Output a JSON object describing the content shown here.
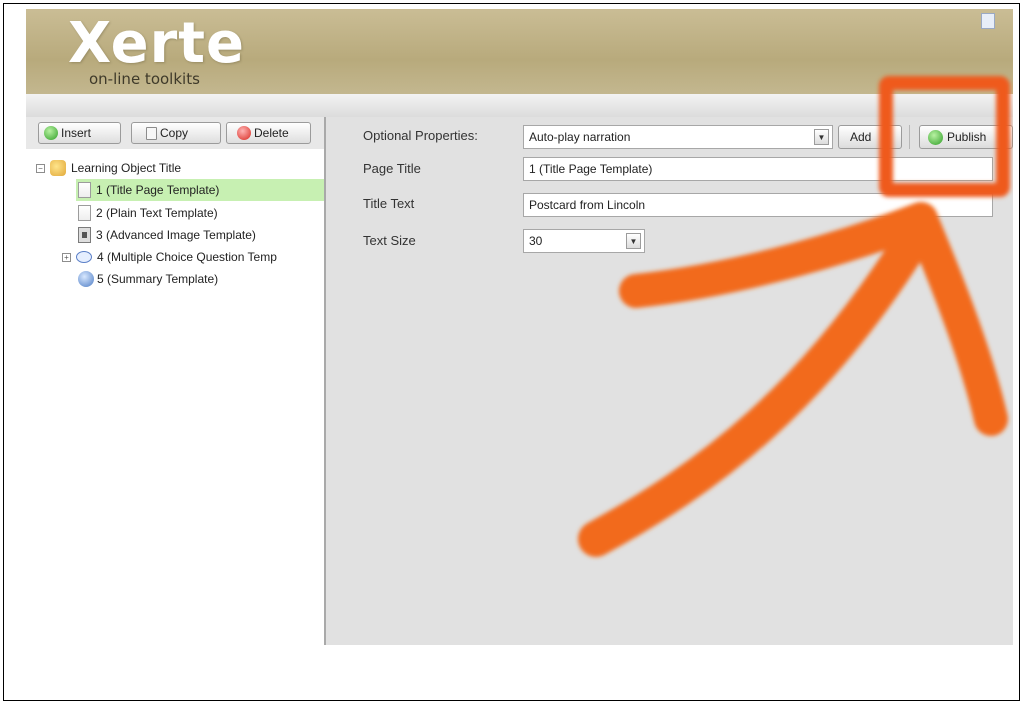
{
  "app": {
    "logo_main": "Xerte",
    "logo_sub": "on-line toolkits"
  },
  "toolbar": {
    "insert_label": "Insert",
    "copy_label": "Copy",
    "delete_label": "Delete"
  },
  "tree": {
    "items": [
      {
        "label": "Learning Object Title",
        "icon": "folder-icon",
        "expander": "−"
      },
      {
        "label": "1 (Title Page Template)",
        "icon": "page-icon",
        "selected": true
      },
      {
        "label": "2 (Plain Text Template)",
        "icon": "page-icon"
      },
      {
        "label": "3 (Advanced Image Template)",
        "icon": "image-icon"
      },
      {
        "label": "4 (Multiple Choice Question Temp",
        "icon": "speech-bubble-icon",
        "expander": "+"
      },
      {
        "label": "5 (Summary Template)",
        "icon": "summary-icon"
      }
    ]
  },
  "properties": {
    "optional_label": "Optional Properties:",
    "optional_value": "Auto-play narration",
    "add_label": "Add",
    "publish_label": "Publish",
    "page_title_label": "Page Title",
    "page_title_value": "1 (Title Page Template)",
    "title_text_label": "Title Text",
    "title_text_value": "Postcard from Lincoln",
    "text_size_label": "Text Size",
    "text_size_value": "30"
  },
  "colors": {
    "banner": "#b8aa7c",
    "selected_row": "#c7f0b2",
    "annotation_orange": "#f26a1b",
    "annotation_box": "#ef5a1a",
    "editor_background": "#e1e1e1"
  }
}
